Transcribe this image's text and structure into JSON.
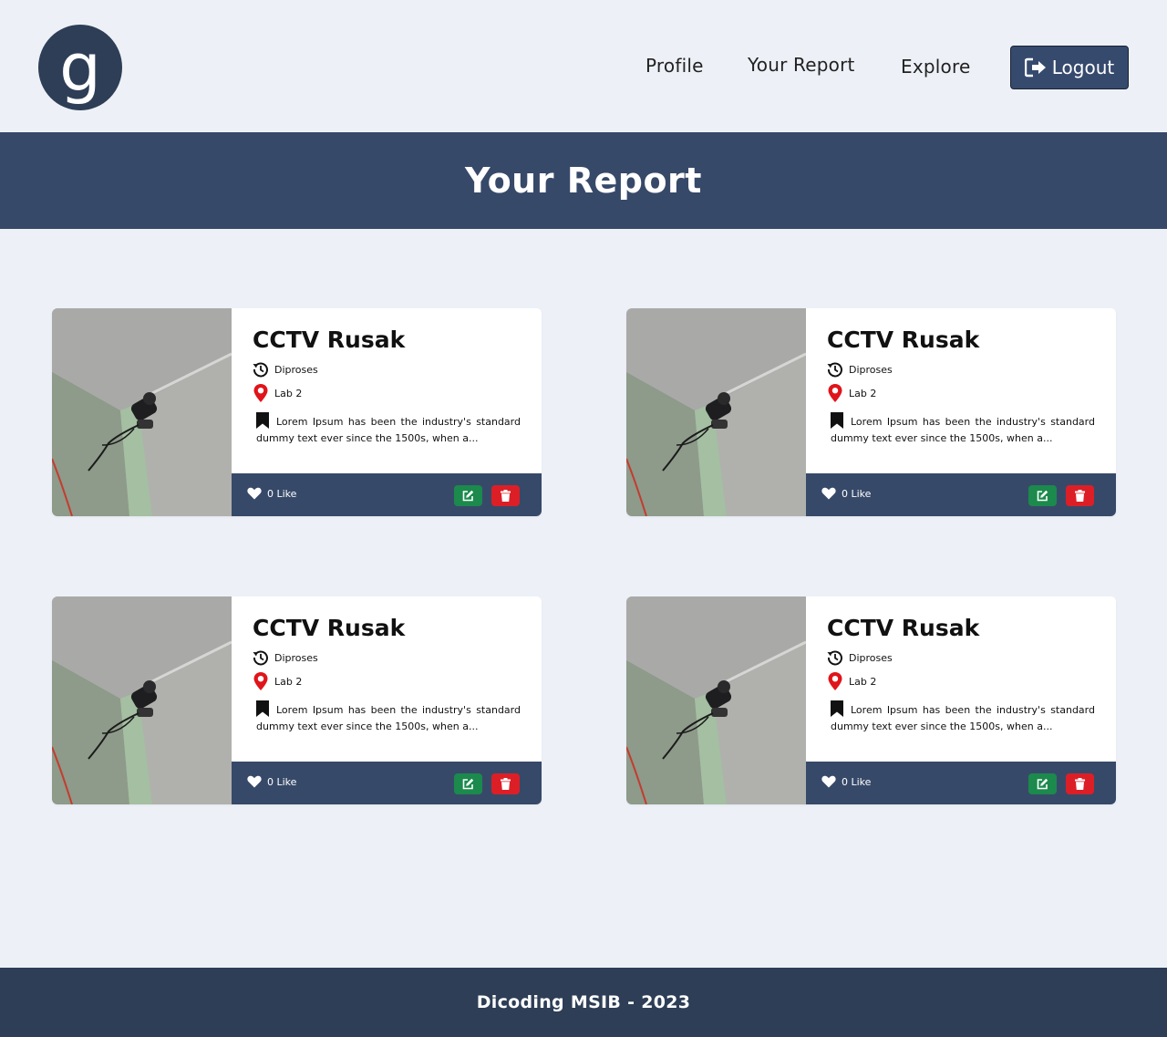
{
  "navbar": {
    "logo_letter": "g",
    "links": [
      {
        "label": "Profile"
      },
      {
        "label": "Your Report"
      },
      {
        "label": "Explore"
      }
    ],
    "logout_label": "Logout"
  },
  "banner": {
    "title": "Your Report"
  },
  "reports": [
    {
      "title": "CCTV Rusak",
      "status": "Diproses",
      "location": "Lab 2",
      "description": "Lorem Ipsum has been the industry's standard dummy text ever since the 1500s, when a...",
      "likes": "0 Like"
    },
    {
      "title": "CCTV Rusak",
      "status": "Diproses",
      "location": "Lab 2",
      "description": "Lorem Ipsum has been the industry's standard dummy text ever since the 1500s, when a...",
      "likes": "0 Like"
    },
    {
      "title": "CCTV Rusak",
      "status": "Diproses",
      "location": "Lab 2",
      "description": "Lorem Ipsum has been the industry's standard dummy text ever since the 1500s, when a...",
      "likes": "0 Like"
    },
    {
      "title": "CCTV Rusak",
      "status": "Diproses",
      "location": "Lab 2",
      "description": "Lorem Ipsum has been the industry's standard dummy text ever since the 1500s, when a...",
      "likes": "0 Like"
    }
  ],
  "footer": {
    "text": "Dicoding MSIB - 2023"
  },
  "icons": {
    "status": "history-icon",
    "location": "map-pin-icon",
    "description": "bookmark-icon",
    "like": "heart-icon",
    "edit": "edit-icon",
    "delete": "trash-icon",
    "logout": "sign-out-icon"
  },
  "colors": {
    "page_bg": "#edf1f7",
    "brand_dark": "#2d3e56",
    "banner": "#374969",
    "edit_button": "#1b8a4c",
    "delete_button": "#dc1f26",
    "location_pin": "#e0141a"
  }
}
